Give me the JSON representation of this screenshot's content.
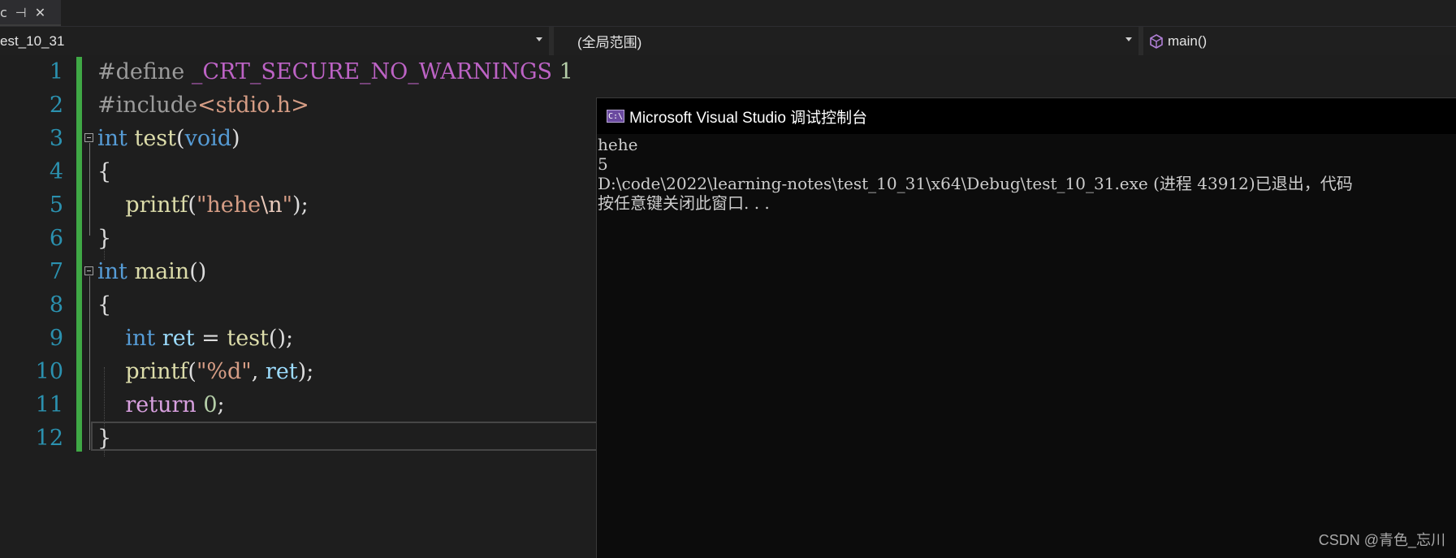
{
  "tab": {
    "icons": [
      "close-small-icon",
      "pin-icon",
      "close-icon"
    ],
    "glyphs": [
      "c",
      "⊣",
      "✕"
    ]
  },
  "navbar": {
    "project": "est_10_31",
    "scope": "(全局范围)",
    "member": "main()"
  },
  "editor": {
    "line_numbers": [
      "1",
      "2",
      "3",
      "4",
      "5",
      "6",
      "7",
      "8",
      "9",
      "10",
      "11",
      "12"
    ],
    "lines": [
      [
        {
          "t": "#define ",
          "c": "pp"
        },
        {
          "t": "_CRT_SECURE_NO_WARNINGS",
          "c": "mac"
        },
        {
          "t": " 1",
          "c": "num"
        }
      ],
      [
        {
          "t": "#include",
          "c": "pp"
        },
        {
          "t": "<stdio.h>",
          "c": "str"
        }
      ],
      [
        {
          "t": "int",
          "c": "kw"
        },
        {
          "t": " ",
          "c": "txt"
        },
        {
          "t": "test",
          "c": "fn"
        },
        {
          "t": "(",
          "c": "txt"
        },
        {
          "t": "void",
          "c": "kw"
        },
        {
          "t": ")",
          "c": "txt"
        }
      ],
      [
        {
          "t": "{",
          "c": "txt"
        }
      ],
      [
        {
          "t": "    ",
          "c": "txt"
        },
        {
          "t": "printf",
          "c": "fn"
        },
        {
          "t": "(",
          "c": "txt"
        },
        {
          "t": "\"hehe",
          "c": "str"
        },
        {
          "t": "\\n",
          "c": "esc"
        },
        {
          "t": "\"",
          "c": "str"
        },
        {
          "t": ");",
          "c": "txt"
        }
      ],
      [
        {
          "t": "}",
          "c": "txt"
        }
      ],
      [
        {
          "t": "int",
          "c": "kw"
        },
        {
          "t": " ",
          "c": "txt"
        },
        {
          "t": "main",
          "c": "fn"
        },
        {
          "t": "()",
          "c": "txt"
        }
      ],
      [
        {
          "t": "{",
          "c": "txt"
        }
      ],
      [
        {
          "t": "    ",
          "c": "txt"
        },
        {
          "t": "int",
          "c": "kw"
        },
        {
          "t": " ",
          "c": "txt"
        },
        {
          "t": "ret",
          "c": "var"
        },
        {
          "t": " = ",
          "c": "txt"
        },
        {
          "t": "test",
          "c": "fn"
        },
        {
          "t": "();",
          "c": "txt"
        }
      ],
      [
        {
          "t": "    ",
          "c": "txt"
        },
        {
          "t": "printf",
          "c": "fn"
        },
        {
          "t": "(",
          "c": "txt"
        },
        {
          "t": "\"%d\"",
          "c": "str"
        },
        {
          "t": ", ",
          "c": "txt"
        },
        {
          "t": "ret",
          "c": "var"
        },
        {
          "t": ");",
          "c": "txt"
        }
      ],
      [
        {
          "t": "    ",
          "c": "txt"
        },
        {
          "t": "return",
          "c": "ctl"
        },
        {
          "t": " ",
          "c": "txt"
        },
        {
          "t": "0",
          "c": "num"
        },
        {
          "t": ";",
          "c": "txt"
        }
      ],
      [
        {
          "t": "}",
          "c": "txt"
        }
      ]
    ]
  },
  "console": {
    "title": "Microsoft Visual Studio 调试控制台",
    "icon_text": "C:\\",
    "lines": [
      "hehe",
      "5",
      "D:\\code\\2022\\learning-notes\\test_10_31\\x64\\Debug\\test_10_31.exe (进程 43912)已退出，代码",
      "按任意键关闭此窗口. . ."
    ]
  },
  "watermark": "CSDN @青色_忘川"
}
